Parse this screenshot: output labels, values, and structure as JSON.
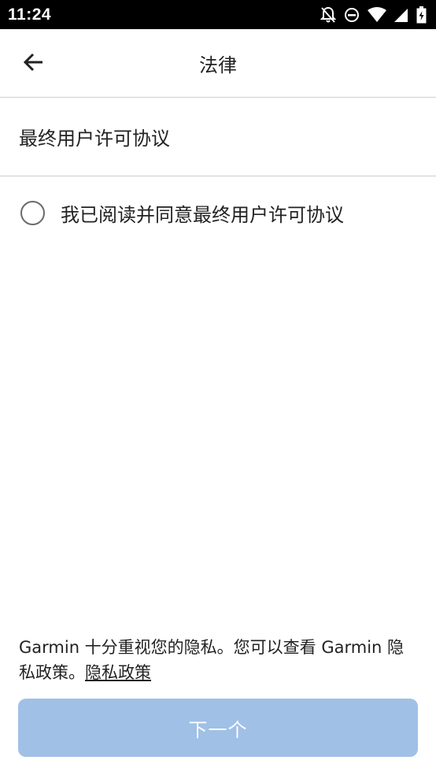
{
  "status_bar": {
    "time": "11:24",
    "icons": [
      "notifications-off-icon",
      "do-not-disturb-icon",
      "wifi-icon",
      "signal-icon",
      "battery-icon"
    ]
  },
  "header": {
    "back_icon": "arrow-left-icon",
    "title": "法律"
  },
  "section": {
    "title": "最终用户许可协议"
  },
  "agreement": {
    "label": "我已阅读并同意最终用户许可协议",
    "checked": false
  },
  "privacy": {
    "text": "Garmin 十分重视您的隐私。您可以查看 Garmin 隐私政策。",
    "link_label": "隐私政策"
  },
  "footer": {
    "next_label": "下一个",
    "enabled": false
  },
  "colors": {
    "status_bar_bg": "#000000",
    "divider": "#cfcfcf",
    "next_button_disabled": "#a0c0e6"
  }
}
